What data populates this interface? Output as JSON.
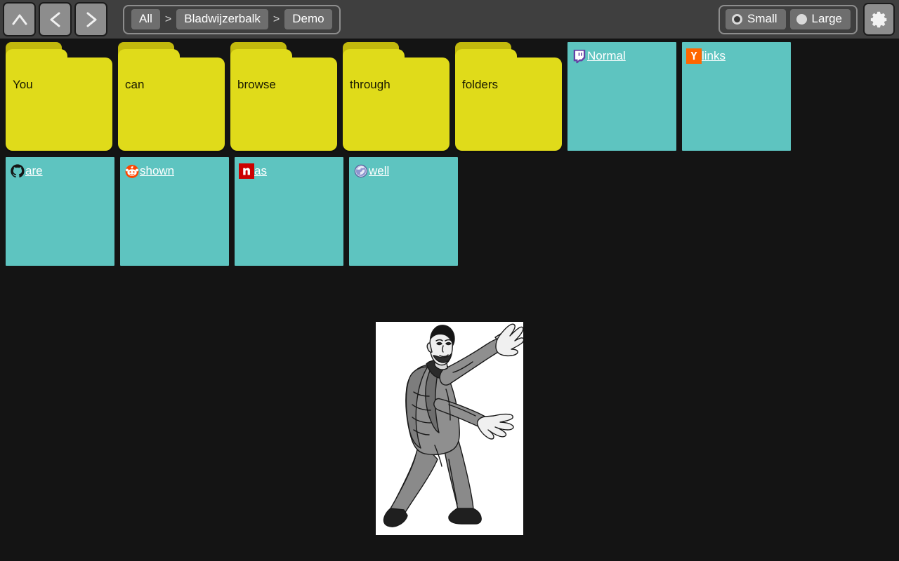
{
  "toolbar": {
    "nav": [
      {
        "name": "up",
        "label": "∧",
        "title": "Up"
      },
      {
        "name": "back",
        "label": "<",
        "title": "Back"
      },
      {
        "name": "forward",
        "label": ">",
        "title": "Forward"
      }
    ],
    "breadcrumb": {
      "separator": ">",
      "items": [
        "All",
        "Bladwijzerbalk",
        "Demo"
      ]
    },
    "size_options": [
      {
        "label": "Small",
        "checked": true
      },
      {
        "label": "Large",
        "checked": false
      }
    ],
    "settings_label": "gear-icon",
    "colors": {
      "toolbar_bg": "#3f3f3f",
      "button_bg": "#8d8d8d",
      "crumb_bg": "#6e6e6e"
    }
  },
  "content": {
    "colors": {
      "page_bg": "#141414",
      "folder_body": "#e0db1a",
      "folder_tab": "#c2b90d",
      "link_tile": "#5ec4c0",
      "link_text": "#ffffff"
    },
    "row1": [
      {
        "type": "folder",
        "label": "You"
      },
      {
        "type": "folder",
        "label": "can"
      },
      {
        "type": "folder",
        "label": "browse"
      },
      {
        "type": "folder",
        "label": "through"
      },
      {
        "type": "folder",
        "label": "folders"
      },
      {
        "type": "link",
        "label": "Normal",
        "icon": "twitch-icon"
      },
      {
        "type": "link",
        "label": "links",
        "icon": "ycombinator-icon"
      }
    ],
    "row2": [
      {
        "type": "link",
        "label": "are",
        "icon": "github-icon"
      },
      {
        "type": "link",
        "label": "shown",
        "icon": "reddit-icon"
      },
      {
        "type": "link",
        "label": "as",
        "icon": "nu-icon"
      },
      {
        "type": "link",
        "label": "well",
        "icon": "globe-icon"
      }
    ],
    "hero": {
      "name": "drake-pointing-illustration",
      "alt": "Grayscale line-art illustration of a man in a grey suit with both arms outstretched"
    }
  }
}
